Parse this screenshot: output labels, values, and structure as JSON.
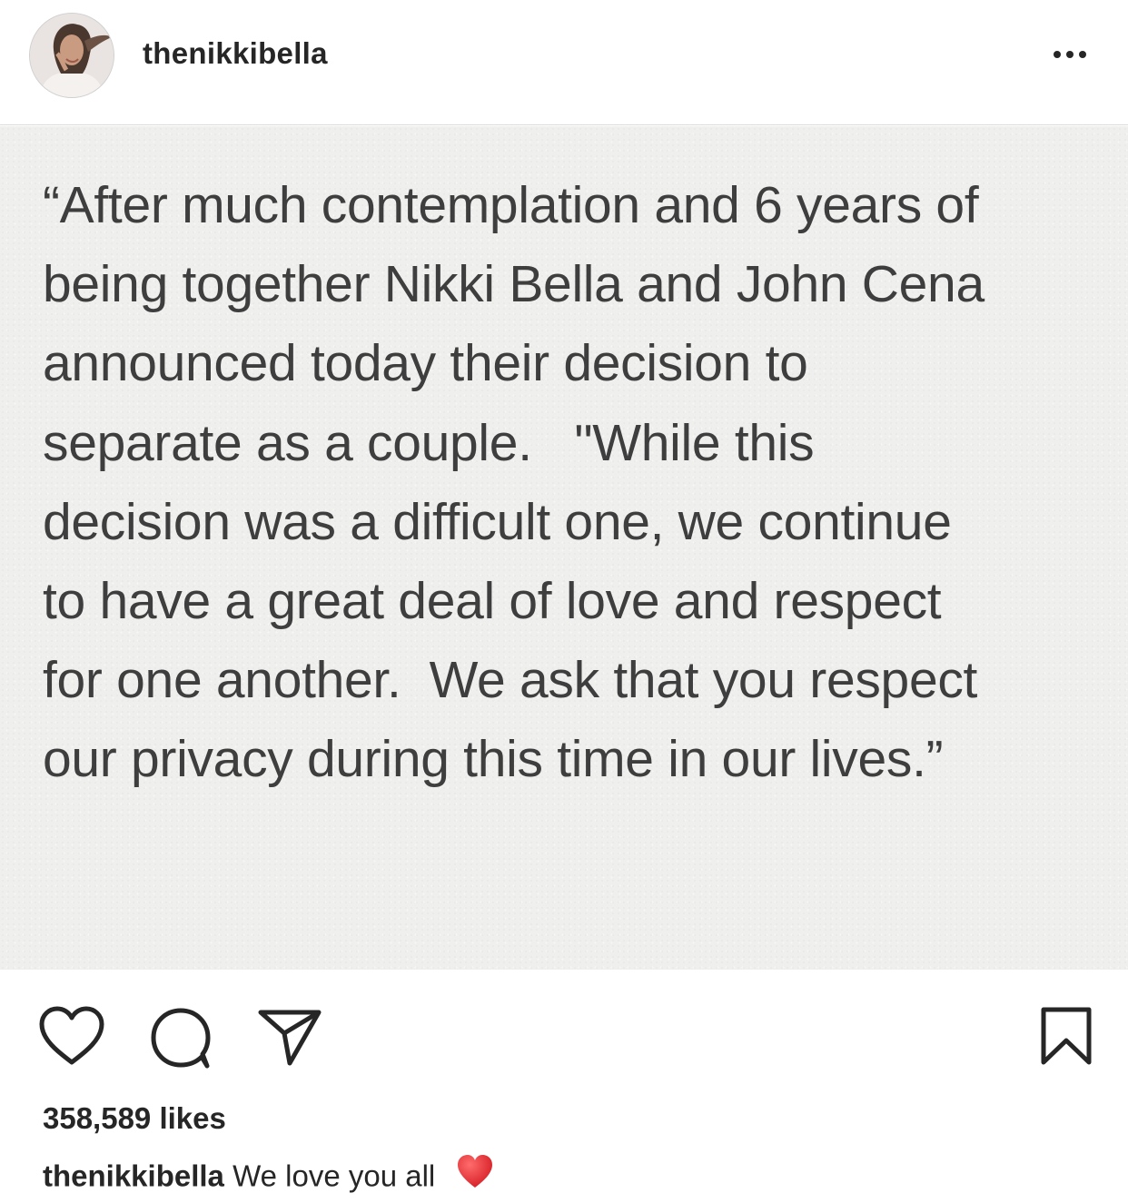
{
  "header": {
    "username": "thenikkibella",
    "avatar_icon": "profile-avatar",
    "more_icon": "more-options-icon"
  },
  "post": {
    "image_text_lines": [
      "“After much contemplation and 6 years of",
      "being together Nikki Bella and John Cena",
      "announced today their decision to",
      "separate as a couple.   \"While this",
      "decision was a difficult one, we continue",
      "to have a great deal of love and respect",
      "for one another.  We ask that you respect",
      "our privacy during this time in our lives.”"
    ]
  },
  "actions": {
    "like_icon": "heart-icon",
    "comment_icon": "comment-icon",
    "share_icon": "share-icon",
    "save_icon": "bookmark-icon"
  },
  "likes": {
    "text": "358,589 likes"
  },
  "caption": {
    "username": "thenikkibella",
    "text": "We love you all",
    "emoji": "red-heart-emoji",
    "emoji_color": "#d8232a"
  },
  "colors": {
    "text": "#262626",
    "border": "#dbdbdb",
    "image_background": "#efefed",
    "image_text": "#3e3e3e"
  }
}
